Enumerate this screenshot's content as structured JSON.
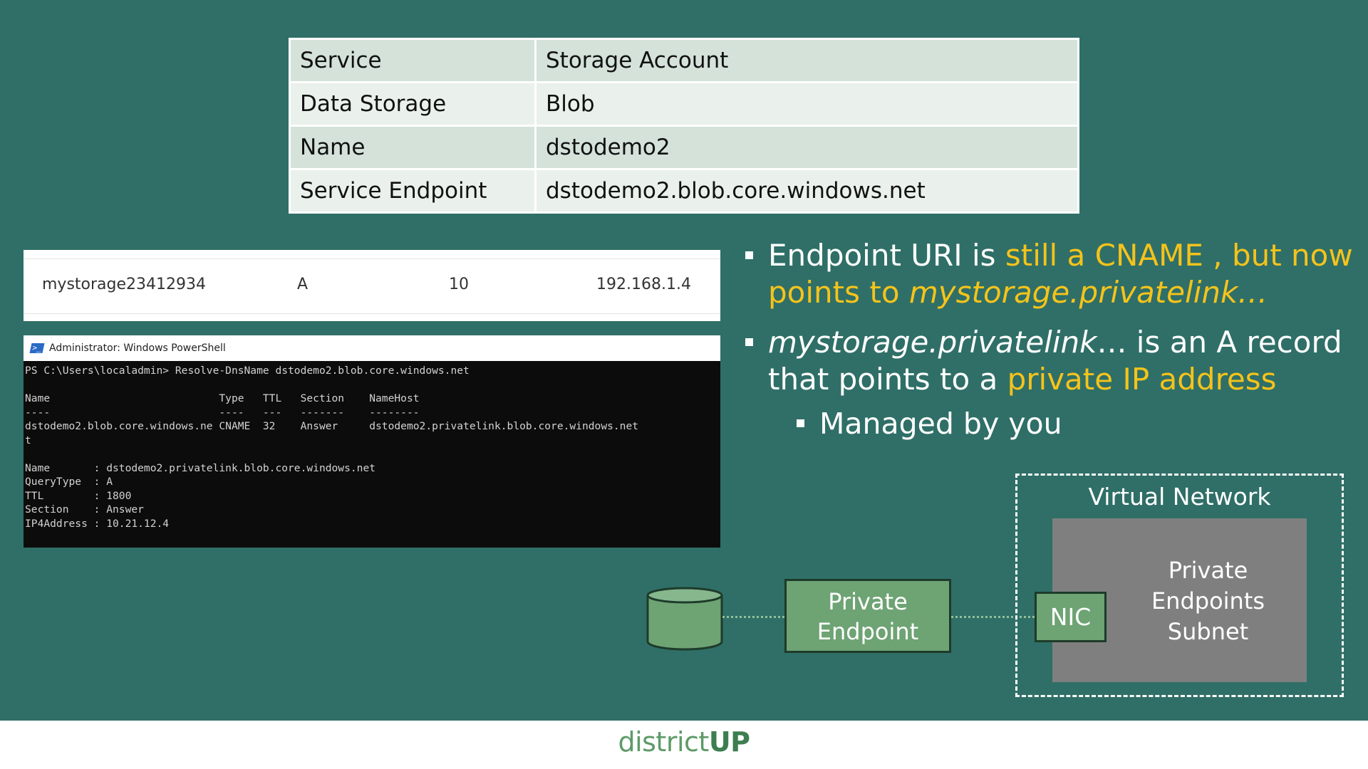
{
  "info_table": {
    "rows": [
      {
        "label": "Service",
        "value": "Storage Account"
      },
      {
        "label": "Data Storage",
        "value": "Blob"
      },
      {
        "label": "Name",
        "value": "dstodemo2"
      },
      {
        "label": "Service Endpoint",
        "value": "dstodemo2.blob.core.windows.net"
      }
    ]
  },
  "dns_record": {
    "name": "mystorage23412934",
    "type": "A",
    "ttl": "10",
    "ip": "192.168.1.4"
  },
  "powershell": {
    "title": "Administrator: Windows PowerShell",
    "output": "PS C:\\Users\\localadmin> Resolve-DnsName dstodemo2.blob.core.windows.net\n\nName                           Type   TTL   Section    NameHost\n----                           ----   ---   -------    --------\ndstodemo2.blob.core.windows.ne CNAME  32    Answer     dstodemo2.privatelink.blob.core.windows.net\nt\n\nName       : dstodemo2.privatelink.blob.core.windows.net\nQueryType  : A\nTTL        : 1800\nSection    : Answer\nIP4Address : 10.21.12.4"
  },
  "bullets": {
    "b1": {
      "t1": "Endpoint URI is ",
      "h1": "still a CNAME , but now points to ",
      "h2": "mystorage.privatelink…"
    },
    "b2": {
      "i1": "mystorage.privatelink",
      "t1": "… is an A record that points to a ",
      "h1": "private IP address"
    },
    "sub": "Managed by you"
  },
  "diagram": {
    "private_endpoint_line1": "Private",
    "private_endpoint_line2": "Endpoint",
    "vnet_label": "Virtual Network",
    "subnet_line1": "Private",
    "subnet_line2": "Endpoints",
    "subnet_line3": "Subnet",
    "nic_label": "NIC",
    "storage_icon": "database-cylinder-icon"
  },
  "footer": {
    "logo_part1": "district",
    "logo_part2": "UP"
  },
  "colors": {
    "background": "#2f6f67",
    "highlight": "#f5c31b",
    "node_green": "#6ea374",
    "subnet_gray": "#7f7f7f"
  }
}
